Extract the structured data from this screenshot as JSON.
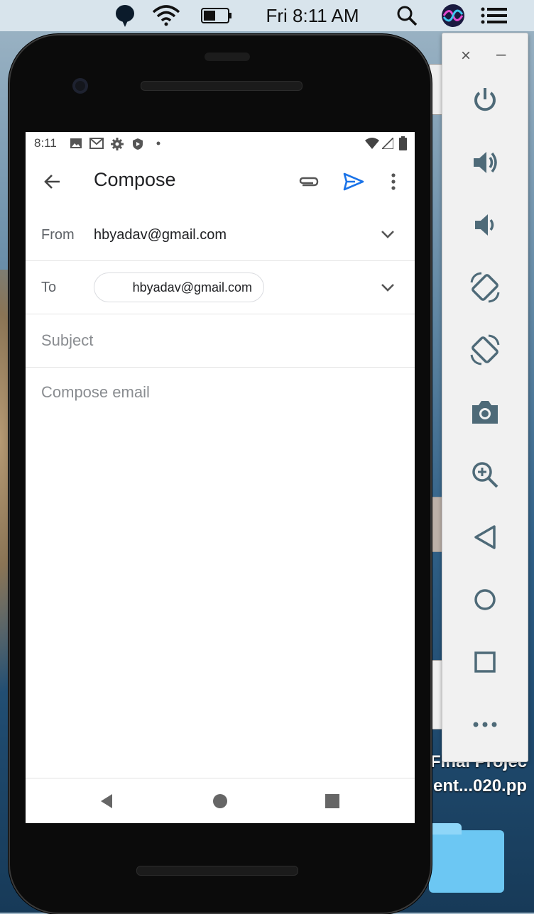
{
  "menubar": {
    "clock": "Fri 8:11 AM",
    "icons": [
      "notification-icon",
      "wifi-icon",
      "battery-icon",
      "spotlight-search-icon",
      "siri-icon",
      "control-center-icon"
    ]
  },
  "desktop": {
    "fragments": [
      "Final Projec",
      "ent...020.pp"
    ]
  },
  "status_bar": {
    "time": "8:11",
    "icons": [
      "image-icon",
      "gmail-icon",
      "settings-icon",
      "shield-icon",
      "dot-icon",
      "wifi-icon",
      "signal-icon",
      "battery-icon"
    ]
  },
  "app_bar": {
    "title": "Compose",
    "accent": "#1a73e8"
  },
  "compose": {
    "from_label": "From",
    "from_value": "hbyadav@gmail.com",
    "to_label": "To",
    "to_chip": "hbyadav@gmail.com",
    "subject_placeholder": "Subject",
    "body_placeholder": "Compose email"
  },
  "nav_bar": {
    "buttons": [
      "back-icon",
      "home-icon",
      "recents-icon"
    ]
  },
  "emulator_panel": {
    "close": "×",
    "minimize": "–",
    "buttons": [
      "power-icon",
      "volume-up-icon",
      "volume-down-icon",
      "rotate-left-icon",
      "rotate-right-icon",
      "screenshot-icon",
      "zoom-icon",
      "back-icon",
      "home-icon",
      "overview-icon",
      "more-icon"
    ]
  }
}
